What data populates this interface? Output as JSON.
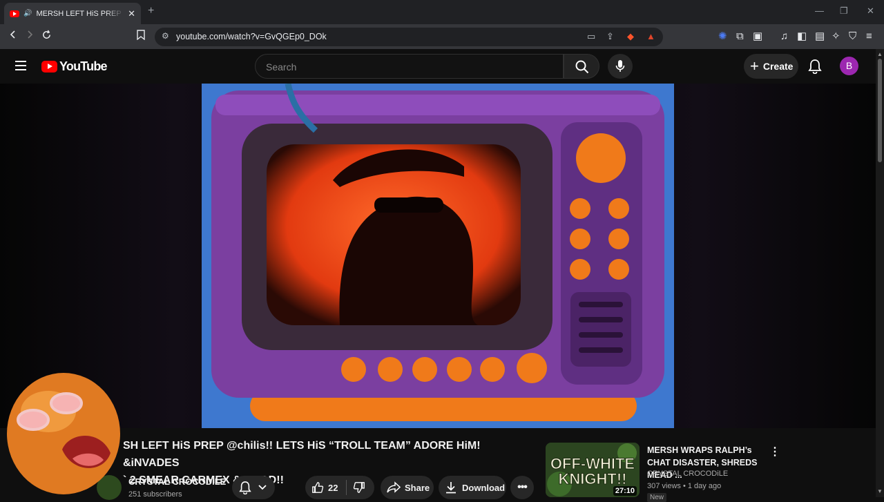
{
  "browser": {
    "tab_title": "MERSH LEFT HiS PREP @chilis!!",
    "url": "youtube.com/watch?v=GvQGEp0_DOk"
  },
  "masthead": {
    "logo_text": "YouTube",
    "search_placeholder": "Search",
    "create_label": "Create",
    "avatar_letter": "B"
  },
  "video": {
    "title": "SH LEFT HiS PREP @chilis!! LETS HiS “TROLL TEAM” ADORE HiM! &iNVADES ` 2 SMEAR CARMEX & MEAD!!",
    "title_line1": "SH LEFT HiS PREP @chilis!! LETS HiS “TROLL TEAM” ADORE HiM! &iNVADES",
    "title_line2": "` 2 SMEAR CARMEX & MEAD!!",
    "channel": "CRYSTAL CROCODiLE",
    "subscribers": "251 subscribers",
    "likes": "22",
    "share_label": "Share",
    "download_label": "Download"
  },
  "recommendation": {
    "title": "MERSH WRAPS RALPH’s CHAT DISASTER, SHREDS MEAD ...",
    "channel": "CRYSTAL CROCODiLE",
    "meta": "307 views • 1 day ago",
    "badge": "New",
    "duration": "27:10",
    "thumb_text_1": "OFF-WHITE",
    "thumb_text_2": "KNIGHT!!"
  },
  "icons": [
    "menu-icon",
    "youtube-logo",
    "search-icon",
    "mic-icon",
    "plus-icon",
    "bell-icon",
    "bell-sub-icon",
    "chevron-down-icon",
    "thumb-up-icon",
    "thumb-down-icon",
    "share-icon",
    "download-icon",
    "more-icon"
  ],
  "colors": {
    "yt_red": "#ff0000",
    "bg": "#0f0f0f",
    "avatar": "#9c27b0",
    "video_bg": "#3f7ad0",
    "tv_purple": "#7b3fa0",
    "tv_orange": "#f07a1a"
  }
}
